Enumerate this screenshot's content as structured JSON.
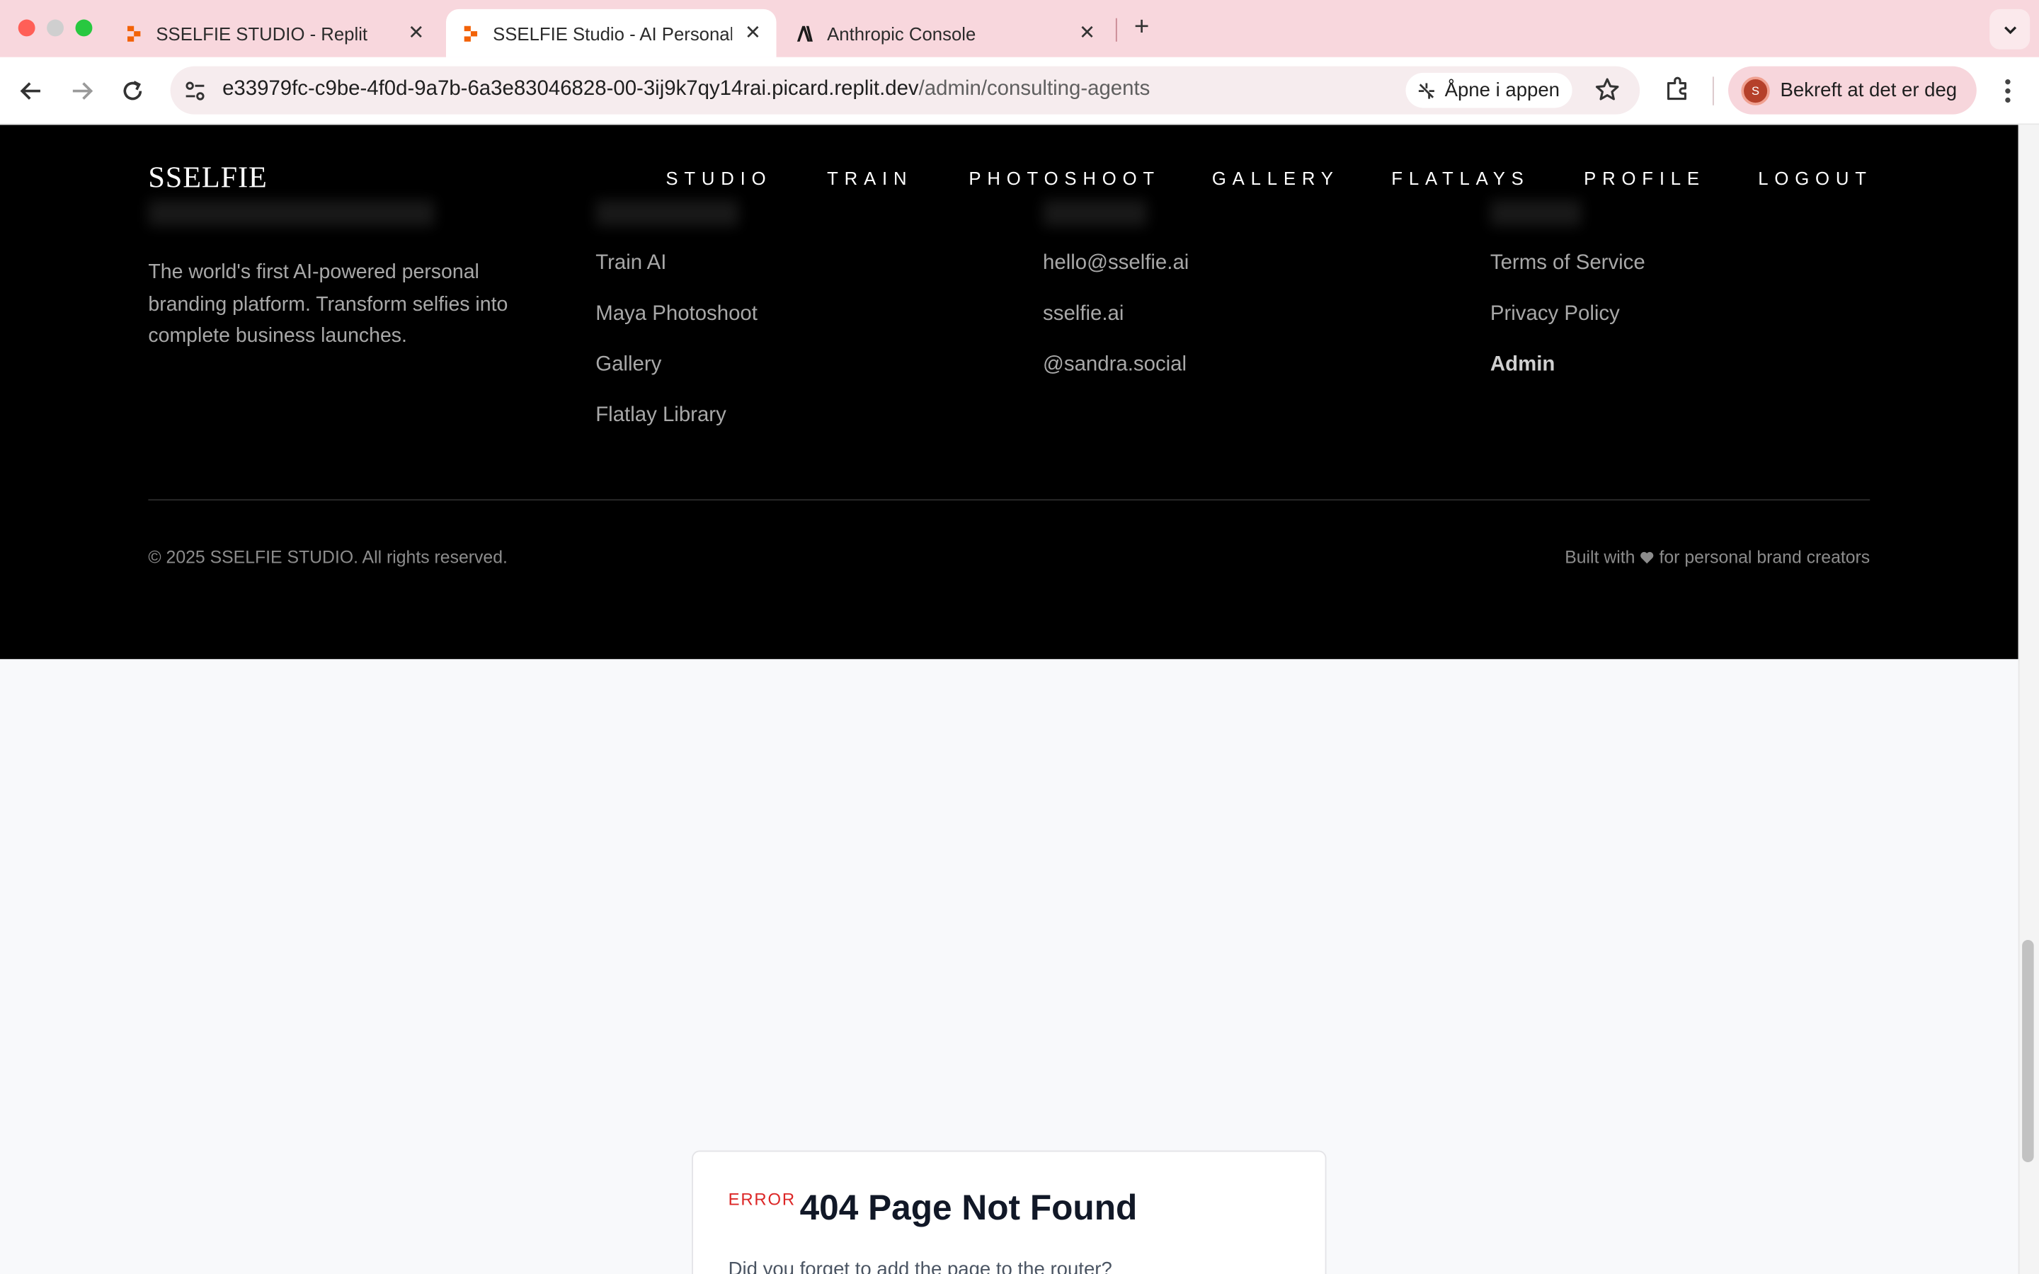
{
  "browser": {
    "tabs": [
      {
        "title": "SSELFIE STUDIO - Replit",
        "active": false,
        "icon": "replit-icon"
      },
      {
        "title": "SSELFIE Studio - AI Personal Branding",
        "active": true,
        "icon": "replit-icon"
      },
      {
        "title": "Anthropic Console",
        "active": false,
        "icon": "anthropic-icon"
      }
    ],
    "url_host": "e33979fc-c9be-4f0d-9a7b-6a3e83046828-00-3ij9k7qy14rai.picard.replit.dev",
    "url_path": "/admin/consulting-agents",
    "open_in_app_label": "Åpne i appen",
    "profile_label": "Bekreft at det er deg",
    "profile_initial": "S"
  },
  "footer": {
    "brand": "SSELFIE",
    "nav": [
      "STUDIO",
      "TRAIN",
      "PHOTOSHOOT",
      "GALLERY",
      "FLATLAYS",
      "PROFILE",
      "LOGOUT"
    ],
    "description": "The world's first AI-powered personal branding platform. Transform selfies into complete business launches.",
    "platform_links": [
      "Train AI",
      "Maya Photoshoot",
      "Gallery",
      "Flatlay Library"
    ],
    "contact_links": [
      "hello@sselfie.ai",
      "sselfie.ai",
      "@sandra.social"
    ],
    "legal_links": [
      "Terms of Service",
      "Privacy Policy",
      "Admin"
    ],
    "copyright": "© 2025 SSELFIE STUDIO. All rights reserved.",
    "built_prefix": "Built with",
    "built_suffix": "for personal brand creators"
  },
  "error_card": {
    "tag": "ERROR",
    "title": "404 Page Not Found",
    "message": "Did you forget to add the page to the router?"
  },
  "colors": {
    "tabbar": "#f8d7dd",
    "footer_bg": "#000000",
    "page_bg": "#f8f9fb",
    "error_red": "#dc2626",
    "replit_orange": "#f26207"
  }
}
